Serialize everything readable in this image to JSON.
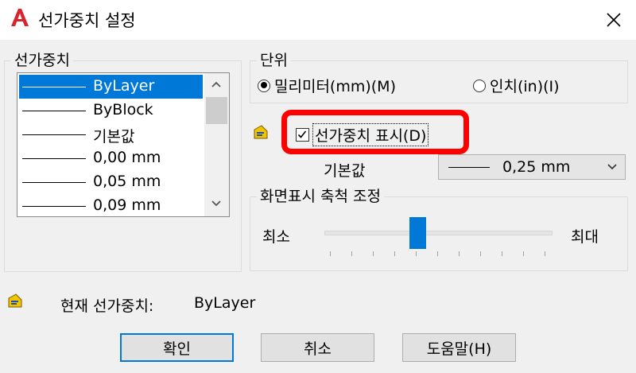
{
  "window": {
    "title": "선가중치 설정",
    "close_icon": "close-icon",
    "app_icon": "autocad-logo-icon",
    "accent_color": "#0078d7",
    "highlight_color": "#ff0000"
  },
  "lineweight_group": {
    "legend": "선가중치",
    "items": [
      {
        "label": "ByLayer",
        "selected": true
      },
      {
        "label": "ByBlock",
        "selected": false
      },
      {
        "label": "기본값",
        "selected": false
      },
      {
        "label": "0,00 mm",
        "selected": false
      },
      {
        "label": "0,05 mm",
        "selected": false
      },
      {
        "label": "0,09 mm",
        "selected": false
      }
    ]
  },
  "units_group": {
    "legend": "단위",
    "options": [
      {
        "label": "밀리미터(mm)(M)",
        "checked": true
      },
      {
        "label": "인치(in)(I)",
        "checked": false
      }
    ]
  },
  "display_lineweight": {
    "label": "선가중치 표시(D)",
    "checked": true,
    "icon": "drawing-settings-icon"
  },
  "default": {
    "label": "기본값",
    "value": "0,25 mm"
  },
  "scale_group": {
    "legend": "화면표시 축척 조정",
    "min_label": "최소",
    "max_label": "최대",
    "position_fraction": 0.41
  },
  "current": {
    "label": "현재 선가중치:",
    "value": "ByLayer",
    "icon": "drawing-settings-icon"
  },
  "buttons": {
    "ok": "확인",
    "cancel": "취소",
    "help": "도움말(H)"
  }
}
